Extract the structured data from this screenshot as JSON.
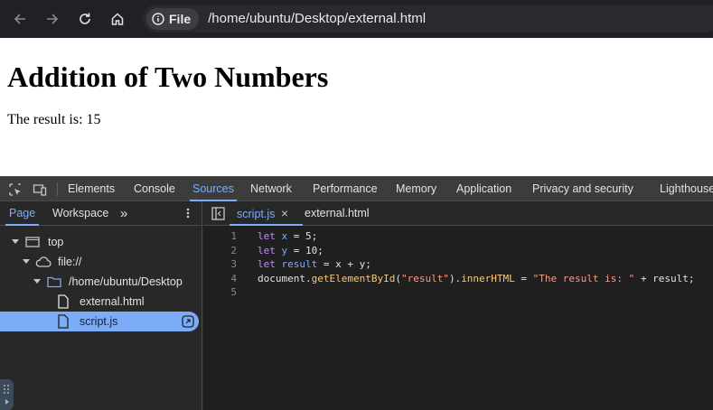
{
  "browser": {
    "chip_label": "File",
    "url": "/home/ubuntu/Desktop/external.html",
    "icons": [
      "back-icon",
      "forward-icon",
      "reload-icon",
      "home-icon",
      "info-icon"
    ]
  },
  "page": {
    "heading": "Addition of Two Numbers",
    "result_text": "The result is: 15"
  },
  "devtools": {
    "tabs": [
      "Elements",
      "Console",
      "Sources",
      "Network",
      "Performance",
      "Memory",
      "Application",
      "Privacy and security",
      "Lighthouse"
    ],
    "active_tab": "Sources",
    "navigator": {
      "tabs": [
        "Page",
        "Workspace"
      ],
      "more": "»",
      "tree": [
        {
          "label": "top",
          "icon": "frame-icon"
        },
        {
          "label": "file://",
          "icon": "cloud-icon"
        },
        {
          "label": "/home/ubuntu/Desktop",
          "icon": "folder-icon"
        },
        {
          "label": "external.html",
          "icon": "file-icon"
        },
        {
          "label": "script.js",
          "icon": "file-icon",
          "selected": true
        }
      ]
    },
    "editor": {
      "tabs": [
        {
          "label": "script.js",
          "active": true,
          "closable": true
        },
        {
          "label": "external.html",
          "active": false
        }
      ],
      "close_glyph": "×",
      "line_numbers": [
        "1",
        "2",
        "3",
        "4",
        "5"
      ],
      "lines": [
        "let x = 5;",
        "let y = 10;",
        "let result = x + y;",
        "document.getElementById(\"result\").innerHTML = \"The result is: \" + result;",
        ""
      ]
    },
    "colors": {
      "accent": "#7cacf8",
      "panel_bg": "#282828",
      "editor_bg": "#1f1f1f",
      "keyword": "#c58af9",
      "string": "#fc9a85"
    }
  }
}
